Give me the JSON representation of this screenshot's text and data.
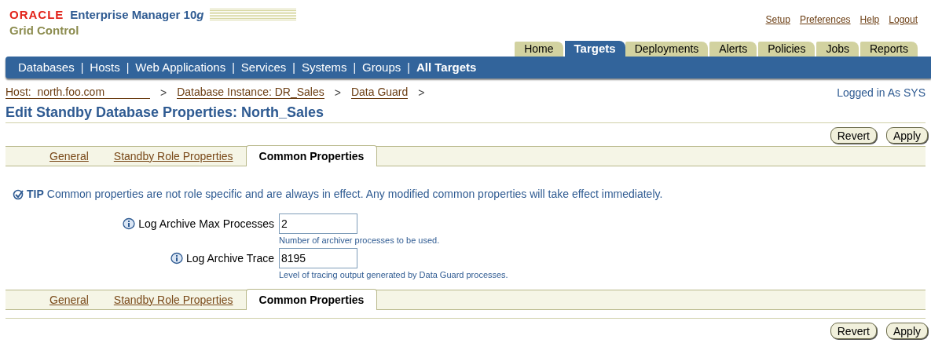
{
  "header": {
    "brand": "ORACLE",
    "product": "Enterprise Manager 10",
    "product_suffix": "g",
    "subtitle": "Grid Control",
    "global_links": [
      "Setup",
      "Preferences",
      "Help",
      "Logout"
    ]
  },
  "tabs": [
    {
      "label": "Home",
      "selected": false
    },
    {
      "label": "Targets",
      "selected": true
    },
    {
      "label": "Deployments",
      "selected": false
    },
    {
      "label": "Alerts",
      "selected": false
    },
    {
      "label": "Policies",
      "selected": false
    },
    {
      "label": "Jobs",
      "selected": false
    },
    {
      "label": "Reports",
      "selected": false
    }
  ],
  "subnav": [
    {
      "label": "Databases",
      "selected": false
    },
    {
      "separator": "|",
      "label": "Hosts",
      "selected": false
    },
    {
      "separator": "|",
      "label": "Web Applications",
      "selected": false
    },
    {
      "separator": "|",
      "label": "Services",
      "selected": false
    },
    {
      "separator": "|",
      "label": "Systems",
      "selected": false
    },
    {
      "separator": "|",
      "label": "Groups",
      "selected": false
    },
    {
      "separator": "|",
      "label": "All Targets",
      "selected": true
    }
  ],
  "breadcrumb": [
    {
      "label": "Host:  north.foo.com",
      "separator": ">"
    },
    {
      "label": "Database Instance: DR_Sales",
      "separator": ">"
    },
    {
      "label": "Data Guard",
      "separator": ">"
    }
  ],
  "logged_in": "Logged in As SYS",
  "page_title": "Edit Standby Database Properties: North_Sales",
  "top_buttons": [
    "Revert",
    "Apply"
  ],
  "top_subtabs": [
    {
      "label": "General",
      "selected": false
    },
    {
      "label": "Standby Role Properties",
      "selected": false
    },
    {
      "label": "Common Properties",
      "selected": true
    }
  ],
  "tip": {
    "label": "TIP",
    "text": "Common properties are not role specific and are always in effect. Any modified common properties will take effect immediately."
  },
  "fields": [
    {
      "label": "Log Archive Max Processes",
      "value": "2",
      "hint": "Number of archiver processes to be used."
    },
    {
      "label": "Log Archive Trace",
      "value": "8195",
      "hint": "Level of tracing output generated by Data Guard processes."
    }
  ],
  "bottom_subtabs": [
    {
      "label": "General",
      "selected": false
    },
    {
      "label": "Standby Role Properties",
      "selected": false
    },
    {
      "label": "Common Properties",
      "selected": true
    }
  ],
  "bottom_buttons": [
    "Revert",
    "Apply"
  ]
}
